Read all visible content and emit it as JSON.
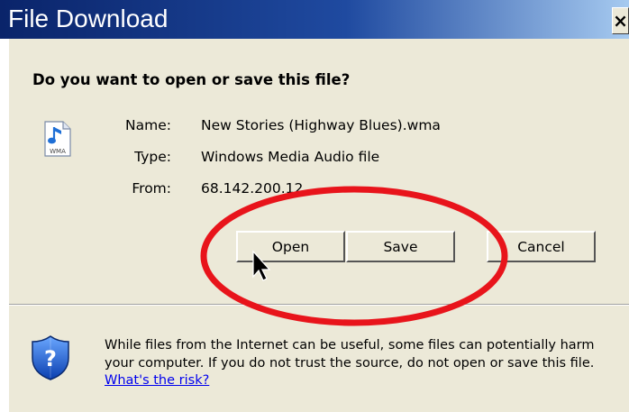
{
  "window": {
    "title": "File Download",
    "close_label": "×"
  },
  "dialog": {
    "question": "Do you want to open or save this file?",
    "file_icon_caption": "WMA",
    "info": {
      "name_label": "Name:",
      "name_value": "New Stories (Highway Blues).wma",
      "type_label": "Type:",
      "type_value": "Windows Media Audio file",
      "from_label": "From:",
      "from_value": "68.142.200.12"
    },
    "buttons": {
      "open": "Open",
      "save": "Save",
      "cancel": "Cancel"
    },
    "warning": {
      "text": "While files from the Internet can be useful, some files can potentially harm your computer. If you do not trust the source, do not open or save this file.",
      "link": "What's the risk?"
    }
  },
  "icons": {
    "file": "audio-file-icon",
    "security": "shield-question-icon",
    "cursor": "mouse-pointer-icon"
  },
  "colors": {
    "title_bar_start": "#0a246a",
    "title_bar_end": "#a6caf0",
    "dialog_bg": "#ece9d8",
    "annotation_circle": "#e8141b",
    "link": "#0000ee"
  }
}
